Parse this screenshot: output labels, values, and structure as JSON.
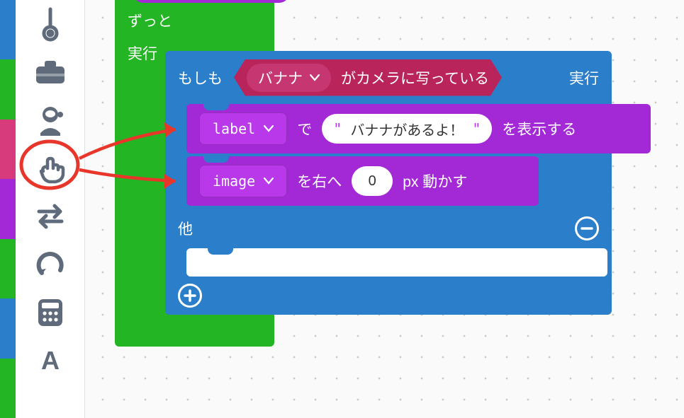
{
  "strip_colors": [
    "#2b7ec9",
    "#24b524",
    "#d83b7b",
    "#a429d6",
    "#24b524",
    "#2b7ec9",
    "#24b524"
  ],
  "nav": {
    "thermometer": "thermometer-icon",
    "toolbox": "toolbox-icon",
    "astronaut": "astronaut-icon",
    "pointer": "pointer-icon",
    "swap": "swap-icon",
    "undo": "undo-icon",
    "calculator": "calculator-icon",
    "text": "text-icon"
  },
  "loop": {
    "label1": "ずっと",
    "label2": "実行"
  },
  "if_block": {
    "if_label": "もしも",
    "exec_label": "実行",
    "else_label": "他",
    "cond_dropdown": "バナナ",
    "cond_suffix": "がカメラに写っている"
  },
  "line1": {
    "selector": "label",
    "mid": "で",
    "text": "バナナがあるよ！",
    "suffix": "を表示する"
  },
  "line2": {
    "selector": "image",
    "pre": "を右へ",
    "value": "0",
    "post": "px 動かす"
  }
}
